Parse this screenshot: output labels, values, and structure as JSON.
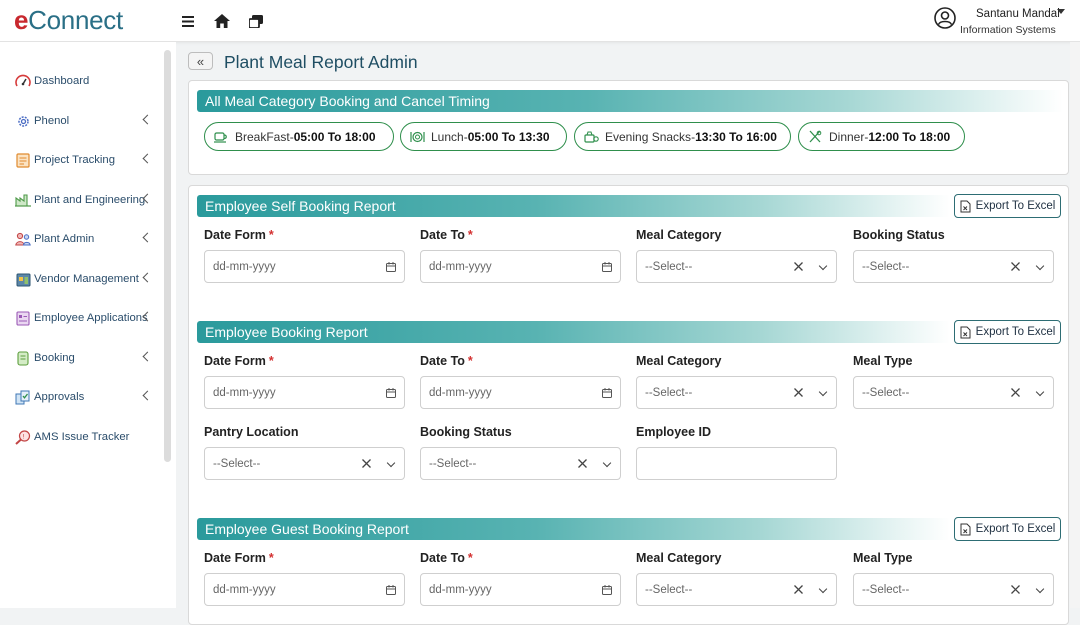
{
  "app": {
    "logo_e": "e",
    "logo_rest": "Connect"
  },
  "user": {
    "name": "Santanu Mandal",
    "dept": "Information Systems"
  },
  "sidebar": {
    "items": [
      {
        "label": "Dashboard",
        "icon": "dashboard-icon",
        "has_children": false
      },
      {
        "label": "Phenol",
        "icon": "gear-icon",
        "has_children": true
      },
      {
        "label": "Project Tracking",
        "icon": "project-icon",
        "has_children": true
      },
      {
        "label": "Plant and Engineering",
        "icon": "plant-icon",
        "has_children": true
      },
      {
        "label": "Plant Admin",
        "icon": "admin-icon",
        "has_children": true
      },
      {
        "label": "Vendor Management",
        "icon": "vendor-icon",
        "has_children": true
      },
      {
        "label": "Employee Applications",
        "icon": "application-icon",
        "has_children": true
      },
      {
        "label": "Booking",
        "icon": "booking-icon",
        "has_children": true
      },
      {
        "label": "Approvals",
        "icon": "approvals-icon",
        "has_children": true
      },
      {
        "label": "AMS Issue Tracker",
        "icon": "tracker-icon",
        "has_children": false
      }
    ]
  },
  "page": {
    "title": "Plant Meal Report Admin",
    "back_label": "«"
  },
  "timing": {
    "header": "All Meal Category Booking and Cancel Timing",
    "meals": [
      {
        "name": "BreakFast",
        "sep": " - ",
        "time": "05:00 To 18:00"
      },
      {
        "name": "Lunch",
        "sep": " - ",
        "time": "05:00 To 13:30"
      },
      {
        "name": "Evening Snacks",
        "sep": " - ",
        "time": "13:30 To 16:00"
      },
      {
        "name": "Dinner",
        "sep": " - ",
        "time": "12:00 To 18:00"
      }
    ]
  },
  "common": {
    "export_label": "Export To Excel",
    "date_placeholder": "dd-mm-yyyy",
    "select_placeholder": "--Select--",
    "required_mark": "*"
  },
  "self_report": {
    "header": "Employee Self Booking Report",
    "labels": {
      "date_from": "Date Form",
      "date_to": "Date To",
      "meal_category": "Meal Category",
      "booking_status": "Booking Status"
    }
  },
  "booking_report": {
    "header": "Employee Booking Report",
    "labels": {
      "date_from": "Date Form",
      "date_to": "Date To",
      "meal_category": "Meal Category",
      "meal_type": "Meal Type",
      "pantry_location": "Pantry Location",
      "booking_status": "Booking Status",
      "employee_id": "Employee ID"
    },
    "employee_id_value": ""
  },
  "guest_report": {
    "header": "Employee Guest Booking Report",
    "labels": {
      "date_from": "Date Form",
      "date_to": "Date To",
      "meal_category": "Meal Category",
      "meal_type": "Meal Type"
    }
  },
  "colors": {
    "accent": "#2a9a9c",
    "pill_border": "#2f8f4c",
    "title": "#1f4e63",
    "required": "#d32f2f",
    "logo_red": "#c8282e"
  }
}
